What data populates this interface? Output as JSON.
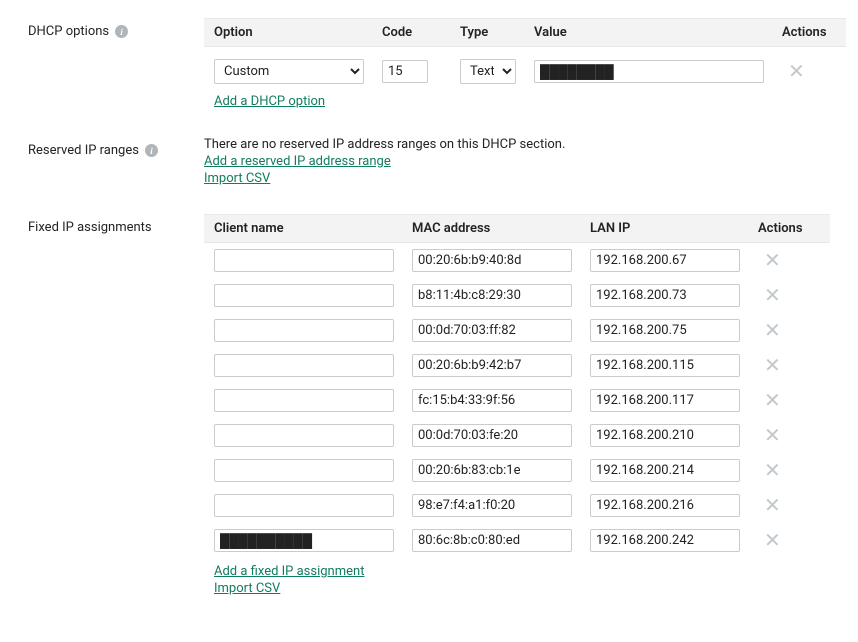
{
  "dhcp_options": {
    "section_label": "DHCP options",
    "headers": {
      "option": "Option",
      "code": "Code",
      "type": "Type",
      "value": "Value",
      "actions": "Actions"
    },
    "row": {
      "option_selected": "Custom",
      "code": "15",
      "type_selected": "Text",
      "value": "████████"
    },
    "add_link": "Add a DHCP option"
  },
  "reserved": {
    "section_label": "Reserved IP ranges",
    "empty_msg": "There are no reserved IP address ranges on this DHCP section.",
    "add_link": "Add a reserved IP address range",
    "import_link": "Import CSV"
  },
  "fixed": {
    "section_label": "Fixed IP assignments",
    "headers": {
      "client": "Client name",
      "mac": "MAC address",
      "lan": "LAN IP",
      "actions": "Actions"
    },
    "rows": [
      {
        "client": "",
        "mac": "00:20:6b:b9:40:8d",
        "lan": "192.168.200.67"
      },
      {
        "client": "",
        "mac": "b8:11:4b:c8:29:30",
        "lan": "192.168.200.73"
      },
      {
        "client": "",
        "mac": "00:0d:70:03:ff:82",
        "lan": "192.168.200.75"
      },
      {
        "client": "",
        "mac": "00:20:6b:b9:42:b7",
        "lan": "192.168.200.115"
      },
      {
        "client": "",
        "mac": "fc:15:b4:33:9f:56",
        "lan": "192.168.200.117"
      },
      {
        "client": "",
        "mac": "00:0d:70:03:fe:20",
        "lan": "192.168.200.210"
      },
      {
        "client": "",
        "mac": "00:20:6b:83:cb:1e",
        "lan": "192.168.200.214"
      },
      {
        "client": "",
        "mac": "98:e7:f4:a1:f0:20",
        "lan": "192.168.200.216"
      },
      {
        "client": "██████████",
        "mac": "80:6c:8b:c0:80:ed",
        "lan": "192.168.200.242",
        "redacted": true
      }
    ],
    "add_link": "Add a fixed IP assignment",
    "import_link": "Import CSV"
  }
}
